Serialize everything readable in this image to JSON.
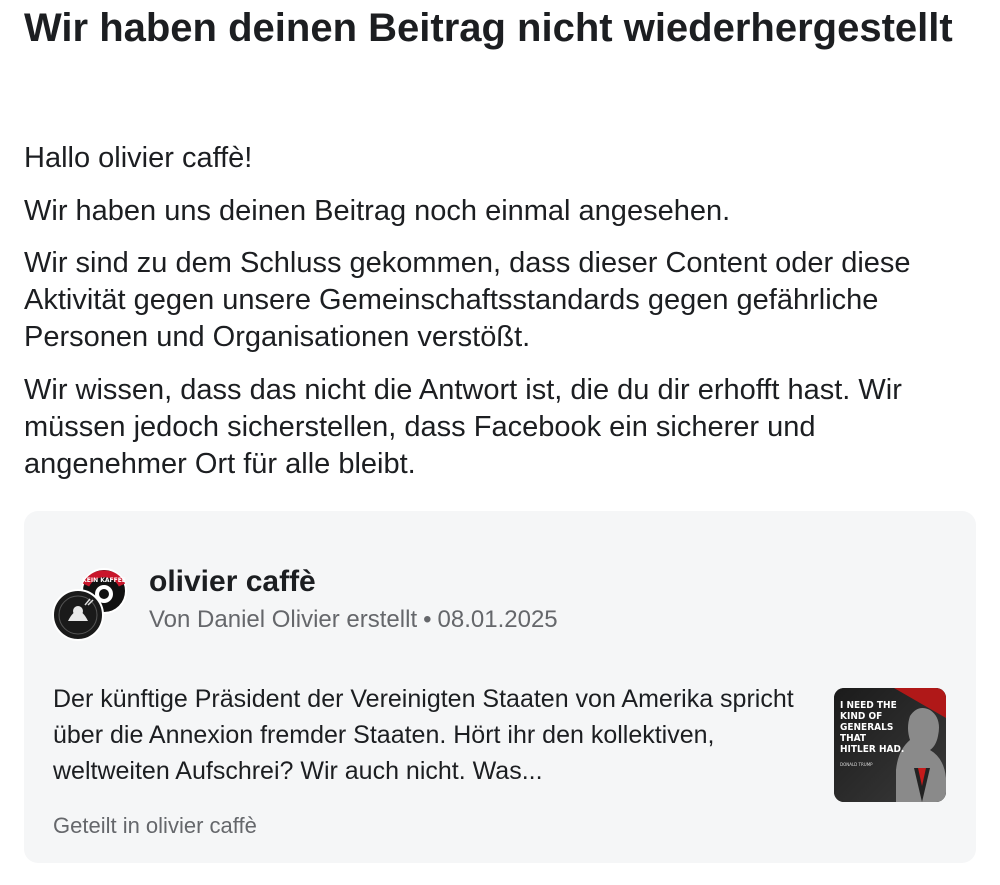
{
  "title": "Wir haben deinen Beitrag nicht wiederhergestellt",
  "paragraphs": {
    "greeting": "Hallo olivier caffè!",
    "review": "Wir haben uns deinen Beitrag noch einmal angesehen.",
    "conclusion": "Wir sind zu dem Schluss gekommen, dass dieser Content oder diese Aktivität gegen unsere Gemeinschaftsstandards gegen gefährliche Personen und Organisationen verstößt.",
    "apology": "Wir wissen, dass das nicht die Antwort ist, die du dir erhofft hast. Wir müssen jedoch sicherstellen, dass Facebook ein sicherer und angenehmer Ort für alle bleibt."
  },
  "post": {
    "author": "olivier caffè",
    "created_by": "Von Daniel Olivier erstellt",
    "separator": "•",
    "date": "08.01.2025",
    "text": "Der künftige Präsident der Vereinigten Staaten von Amerika spricht über die Annexion fremder Staaten. Hört ihr den kollektiven, weltweiten Aufschrei? Wir auch nicht. Was...",
    "shared_in": "Geteilt in olivier caffè",
    "avatar_badge_text": "KEIN KAFFEE",
    "thumbnail": {
      "quote_lines": [
        "I NEED THE",
        "KIND OF",
        "GENERALS",
        "THAT",
        "HITLER HAD."
      ],
      "attribution": "DONALD TRUMP"
    }
  }
}
